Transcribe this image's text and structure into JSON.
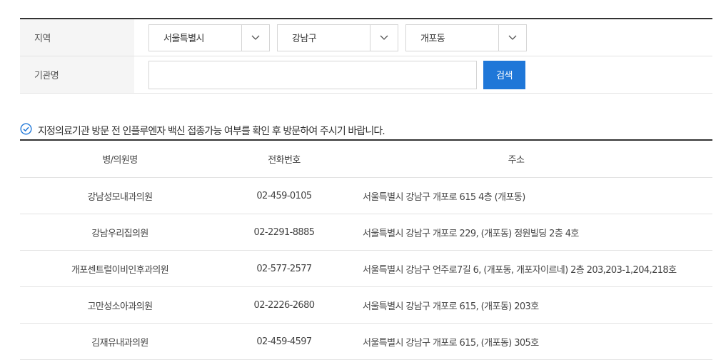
{
  "form": {
    "region_label": "지역",
    "institution_label": "기관명",
    "selects": [
      {
        "value": "서울특별시",
        "width": 0
      },
      {
        "value": "강남구"
      },
      {
        "value": "개포동"
      }
    ],
    "institution_value": "",
    "institution_placeholder": "",
    "search_label": "검색"
  },
  "notice": {
    "icon": "check-circle-icon",
    "text": "지정의료기관 방문 전 인플루엔자 백신 접종가능 여부를 확인 후 방문하여 주시기 바랍니다."
  },
  "table": {
    "headers": [
      "병/의원명",
      "전화번호",
      "주소"
    ],
    "rows": [
      {
        "name": "강남성모내과의원",
        "tel": "02-459-0105",
        "addr": "서울특별시 강남구 개포로 615 4층 (개포동)"
      },
      {
        "name": "강남우리집의원",
        "tel": "02-2291-8885",
        "addr": "서울특별시 강남구 개포로 229, (개포동) 정원빌딩 2층 4호"
      },
      {
        "name": "개포센트럴이비인후과의원",
        "tel": "02-577-2577",
        "addr": "서울특별시 강남구 언주로7길 6, (개포동, 개포자이르네) 2층 203,203-1,204,218호"
      },
      {
        "name": "고만성소아과의원",
        "tel": "02-2226-2680",
        "addr": "서울특별시 강남구 개포로 615, (개포동) 203호"
      },
      {
        "name": "김재유내과의원",
        "tel": "02-459-4597",
        "addr": "서울특별시 강남구 개포로 615, (개포동) 305호"
      }
    ]
  },
  "colors": {
    "accent": "#1f77d8",
    "border": "#d5d5d5",
    "label_bg": "#f5f5f5"
  }
}
